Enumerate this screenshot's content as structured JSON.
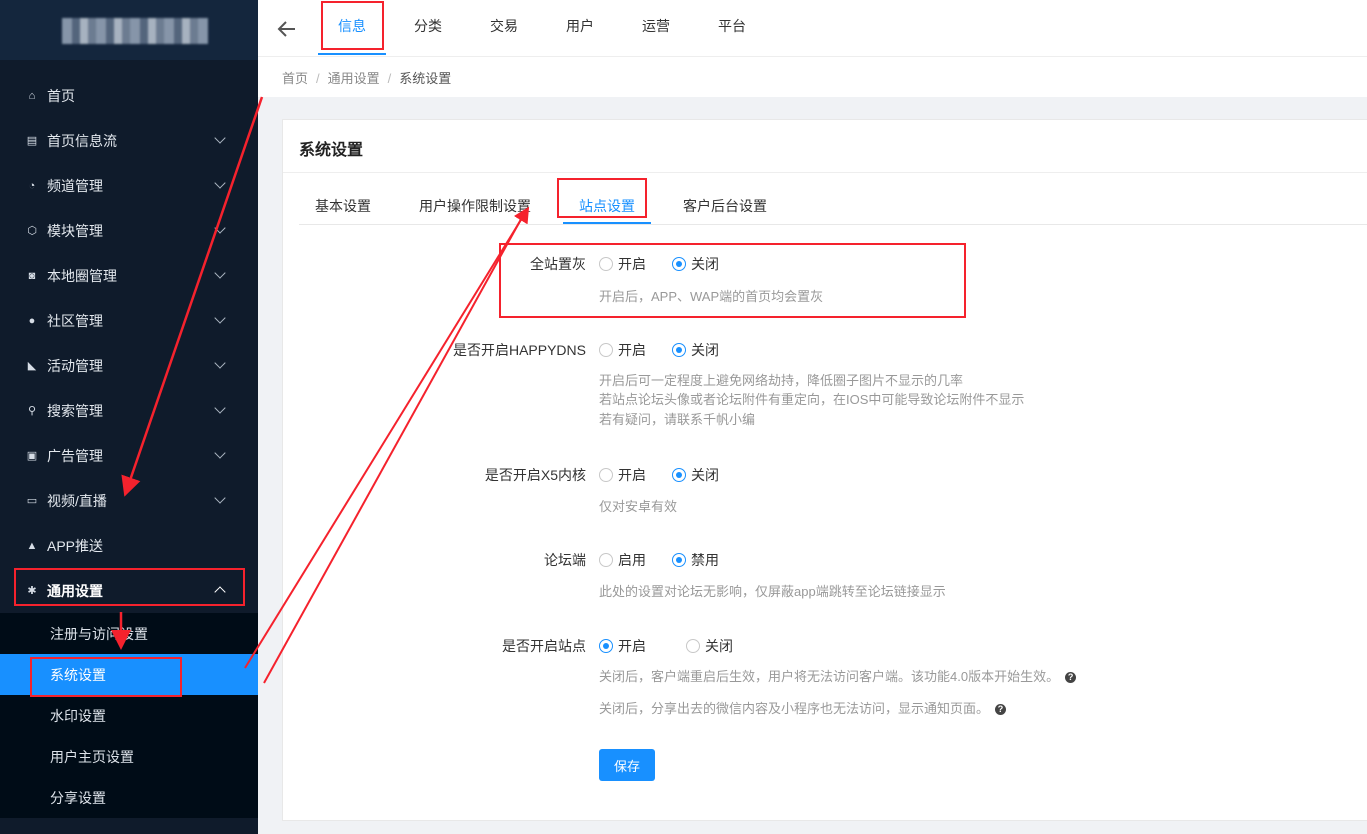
{
  "sidebar": {
    "items": [
      {
        "icon": "home-icon",
        "glyph": "⌂",
        "label": "首页",
        "chevron": false
      },
      {
        "icon": "feed-icon",
        "glyph": "▤",
        "label": "首页信息流",
        "chevron": true
      },
      {
        "icon": "rss-icon",
        "glyph": "◔",
        "label": "频道管理",
        "chevron": true
      },
      {
        "icon": "cube-icon",
        "glyph": "⬡",
        "label": "模块管理",
        "chevron": true
      },
      {
        "icon": "camera-icon",
        "glyph": "◙",
        "label": "本地圈管理",
        "chevron": true
      },
      {
        "icon": "user-circle-icon",
        "glyph": "●",
        "label": "社区管理",
        "chevron": true
      },
      {
        "icon": "megaphone-icon",
        "glyph": "◣",
        "label": "活动管理",
        "chevron": true
      },
      {
        "icon": "search-icon",
        "glyph": "⚲",
        "label": "搜索管理",
        "chevron": true
      },
      {
        "icon": "image-icon",
        "glyph": "▣",
        "label": "广告管理",
        "chevron": true
      },
      {
        "icon": "video-icon",
        "glyph": "▭",
        "label": "视频/直播",
        "chevron": true
      },
      {
        "icon": "bell-icon",
        "glyph": "▲",
        "label": "APP推送",
        "chevron": false
      },
      {
        "icon": "gear-icon",
        "glyph": "✱",
        "label": "通用设置",
        "chevron": true
      }
    ],
    "submenu": [
      "注册与访问设置",
      "系统设置",
      "水印设置",
      "用户主页设置",
      "分享设置"
    ]
  },
  "topnav": {
    "tabs": [
      "信息",
      "分类",
      "交易",
      "用户",
      "运营",
      "平台"
    ],
    "active_index": 0
  },
  "breadcrumb": [
    "首页",
    "通用设置",
    "系统设置"
  ],
  "card": {
    "title": "系统设置",
    "tabs": [
      "基本设置",
      "用户操作限制设置",
      "站点设置",
      "客户后台设置"
    ],
    "active_tab": 2
  },
  "form": {
    "gray": {
      "label": "全站置灰",
      "options": [
        "开启",
        "关闭"
      ],
      "selected": 1,
      "hint": "开启后，APP、WAP端的首页均会置灰"
    },
    "happydns": {
      "label": "是否开启HAPPYDNS",
      "options": [
        "开启",
        "关闭"
      ],
      "selected": 1,
      "hint1": "开启后可一定程度上避免网络劫持，降低圈子图片不显示的几率",
      "hint2": "若站点论坛头像或者论坛附件有重定向，在IOS中可能导致论坛附件不显示",
      "hint3": "若有疑问，请联系千帆小编"
    },
    "x5": {
      "label": "是否开启X5内核",
      "options": [
        "开启",
        "关闭"
      ],
      "selected": 1,
      "hint": "仅对安卓有效"
    },
    "forum": {
      "label": "论坛端",
      "options": [
        "启用",
        "禁用"
      ],
      "selected": 1,
      "hint": "此处的设置对论坛无影响，仅屏蔽app端跳转至论坛链接显示"
    },
    "site": {
      "label": "是否开启站点",
      "options": [
        "开启",
        "关闭"
      ],
      "selected": 0,
      "hint1": "关闭后，客户端重启后生效，用户将无法访问客户端。该功能4.0版本开始生效。",
      "hint2": "关闭后，分享出去的微信内容及小程序也无法访问，显示通知页面。"
    },
    "save_label": "保存"
  },
  "colors": {
    "accent": "#1890ff",
    "sidebar_bg": "#0f1b2b",
    "annotation": "#f5222d"
  }
}
